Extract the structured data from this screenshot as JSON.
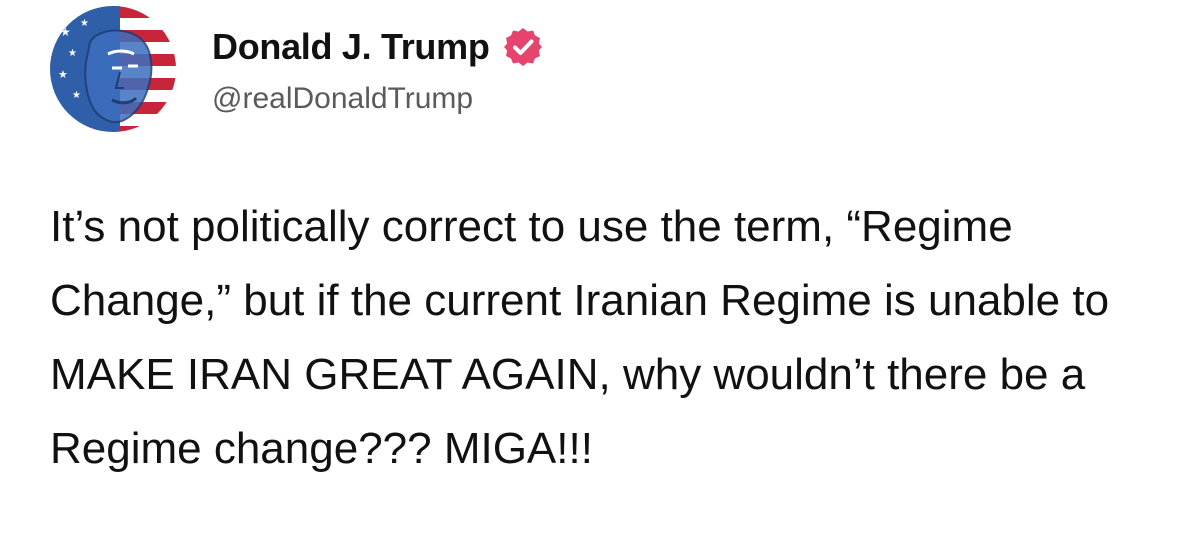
{
  "post": {
    "author": {
      "display_name": "Donald J. Trump",
      "handle": "@realDonaldTrump",
      "verified": true,
      "verified_icon": "verified-badge-icon",
      "verified_color": "#e5446d",
      "avatar_icon": "profile-avatar"
    },
    "text": "It’s not politically correct to use the term, “Regime Change,” but if the current Iranian Regime is unable to MAKE IRAN GREAT AGAIN, why wouldn’t there be a Regime change??? MIGA!!!"
  }
}
